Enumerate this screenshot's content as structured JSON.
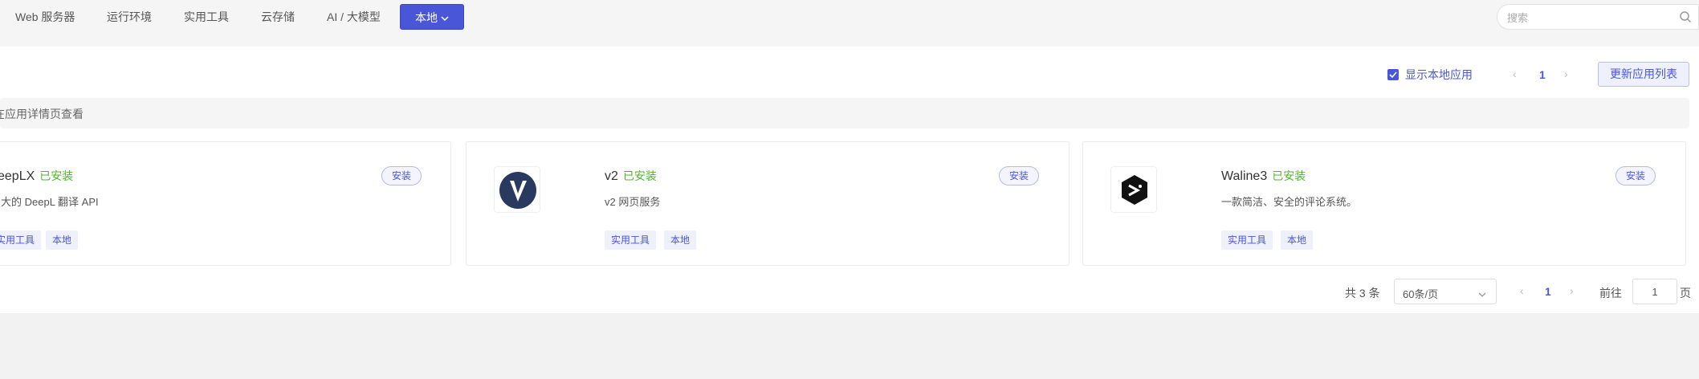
{
  "nav": {
    "tabs": [
      "Web 服务器",
      "运行环境",
      "实用工具",
      "云存储",
      "AI / 大模型"
    ],
    "active_tab": "本地"
  },
  "search": {
    "placeholder": "搜索",
    "value": ""
  },
  "toolbar": {
    "show_local_label": "显示本地应用",
    "show_local_checked": true,
    "page": "1",
    "update_button": "更新应用列表"
  },
  "notice": {
    "text": "在应用详情页查看"
  },
  "apps": [
    {
      "name": "eepLX",
      "status": "已安装",
      "description": "大的 DeepL 翻译 API",
      "install_label": "安装",
      "tags": [
        "实用工具",
        "本地"
      ]
    },
    {
      "name": "v2",
      "status": "已安装",
      "description": "v2 网页服务",
      "install_label": "安装",
      "tags": [
        "实用工具",
        "本地"
      ],
      "icon": "v2-logo-icon"
    },
    {
      "name": "Waline3",
      "status": "已安装",
      "description": "一款简洁、安全的评论系统。",
      "install_label": "安装",
      "tags": [
        "实用工具",
        "本地"
      ],
      "icon": "waline-logo-icon"
    }
  ],
  "pagination": {
    "total": "共 3 条",
    "page_size": "60条/页",
    "current_page": "1",
    "goto_label": "前往",
    "goto_value": "1",
    "page_suffix": "页"
  },
  "colors": {
    "accent": "#4a56d8",
    "installed": "#52b52a"
  }
}
